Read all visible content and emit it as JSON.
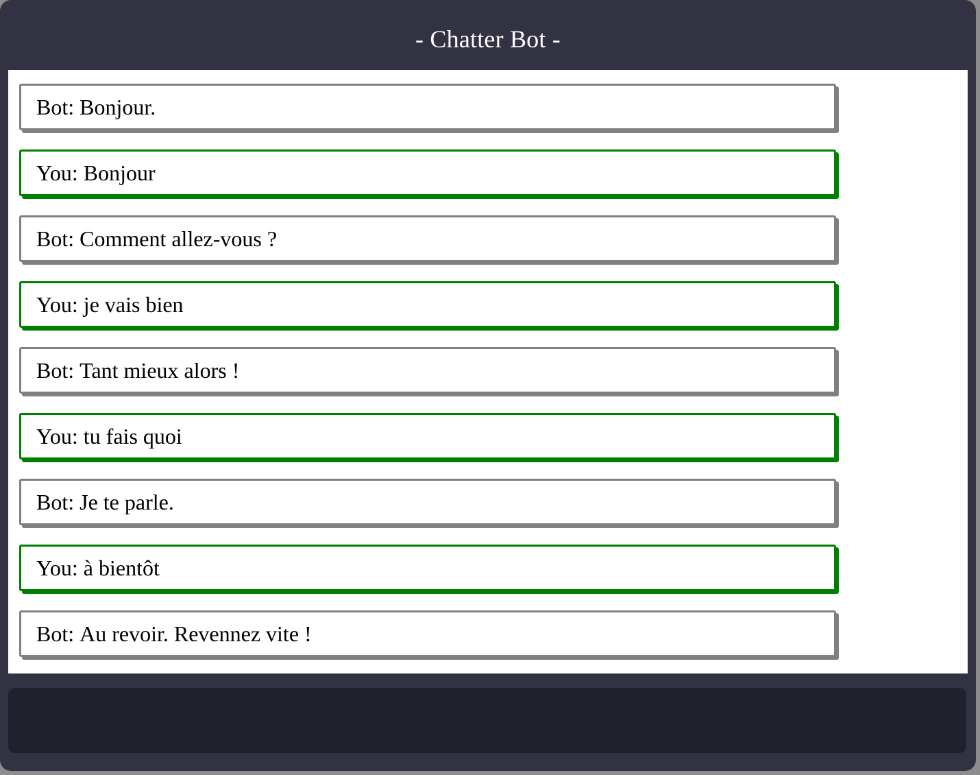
{
  "app": {
    "title": "- Chatter Bot -"
  },
  "colors": {
    "window_background": "#323242",
    "input_background": "#21212e",
    "bot_border": "#808080",
    "user_border": "#008000"
  },
  "messages": [
    {
      "speaker": "Bot",
      "text": "Bonjour.",
      "role": "bot"
    },
    {
      "speaker": "You",
      "text": "Bonjour",
      "role": "user"
    },
    {
      "speaker": "Bot",
      "text": "Comment allez-vous ?",
      "role": "bot"
    },
    {
      "speaker": "You",
      "text": "je vais bien",
      "role": "user"
    },
    {
      "speaker": "Bot",
      "text": "Tant mieux alors !",
      "role": "bot"
    },
    {
      "speaker": "You",
      "text": "tu fais quoi",
      "role": "user"
    },
    {
      "speaker": "Bot",
      "text": "Je te parle.",
      "role": "bot"
    },
    {
      "speaker": "You",
      "text": "à bientôt",
      "role": "user"
    },
    {
      "speaker": "Bot",
      "text": "Au revoir. Revennez vite !",
      "role": "bot"
    }
  ],
  "input": {
    "value": ""
  }
}
